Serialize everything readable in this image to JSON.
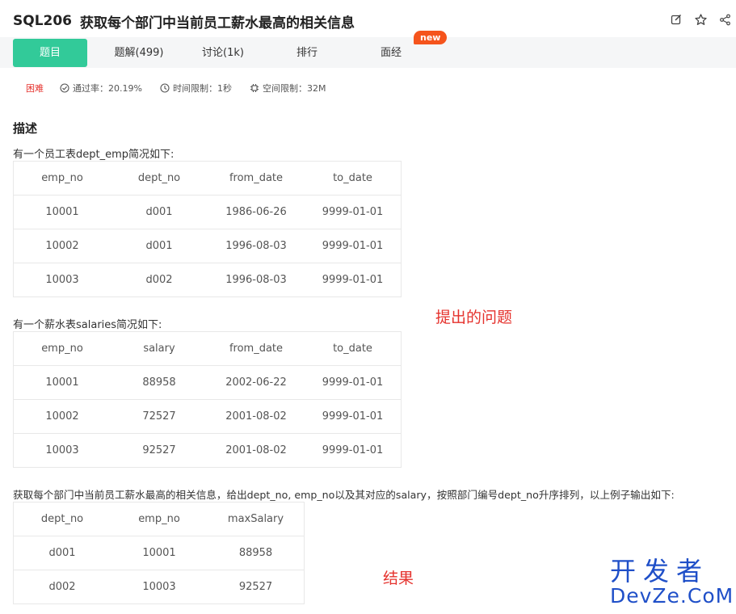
{
  "header": {
    "code": "SQL206",
    "title": "获取每个部门中当前员工薪水最高的相关信息"
  },
  "tabs": [
    {
      "label": "题目"
    },
    {
      "label": "题解(499)"
    },
    {
      "label": "讨论(1k)"
    },
    {
      "label": "排行"
    },
    {
      "label": "面经"
    }
  ],
  "new_badge": "new",
  "meta": {
    "difficulty": "困难",
    "pass_rate": "通过率：20.19%",
    "time_limit": "时间限制：1秒",
    "space_limit": "空间限制：32M"
  },
  "description": {
    "heading": "描述",
    "intro1": "有一个员工表dept_emp简况如下:",
    "intro2": "有一个薪水表salaries简况如下:",
    "question": "获取每个部门中当前员工薪水最高的相关信息，给出dept_no, emp_no以及其对应的salary，按照部门编号dept_no升序排列，以上例子输出如下:"
  },
  "table_dept_emp": {
    "headers": [
      "emp_no",
      "dept_no",
      "from_date",
      "to_date"
    ],
    "rows": [
      [
        "10001",
        "d001",
        "1986-06-26",
        "9999-01-01"
      ],
      [
        "10002",
        "d001",
        "1996-08-03",
        "9999-01-01"
      ],
      [
        "10003",
        "d002",
        "1996-08-03",
        "9999-01-01"
      ]
    ]
  },
  "table_salaries": {
    "headers": [
      "emp_no",
      "salary",
      "from_date",
      "to_date"
    ],
    "rows": [
      [
        "10001",
        "88958",
        "2002-06-22",
        "9999-01-01"
      ],
      [
        "10002",
        "72527",
        "2001-08-02",
        "9999-01-01"
      ],
      [
        "10003",
        "92527",
        "2001-08-02",
        "9999-01-01"
      ]
    ]
  },
  "table_result": {
    "headers": [
      "dept_no",
      "emp_no",
      "maxSalary"
    ],
    "rows": [
      [
        "d001",
        "10001",
        "88958"
      ],
      [
        "d002",
        "10003",
        "92527"
      ]
    ]
  },
  "annotations": {
    "question_label": "提出的问题",
    "result_label": "结果"
  },
  "watermark": {
    "cn": "开发者",
    "en": "DevZe.CoM"
  },
  "colors": {
    "accent": "#32ca99",
    "difficulty": "#e5322d",
    "badge": "#f5541c",
    "annotation": "#e5322d",
    "watermark": "#1f4fc8"
  }
}
